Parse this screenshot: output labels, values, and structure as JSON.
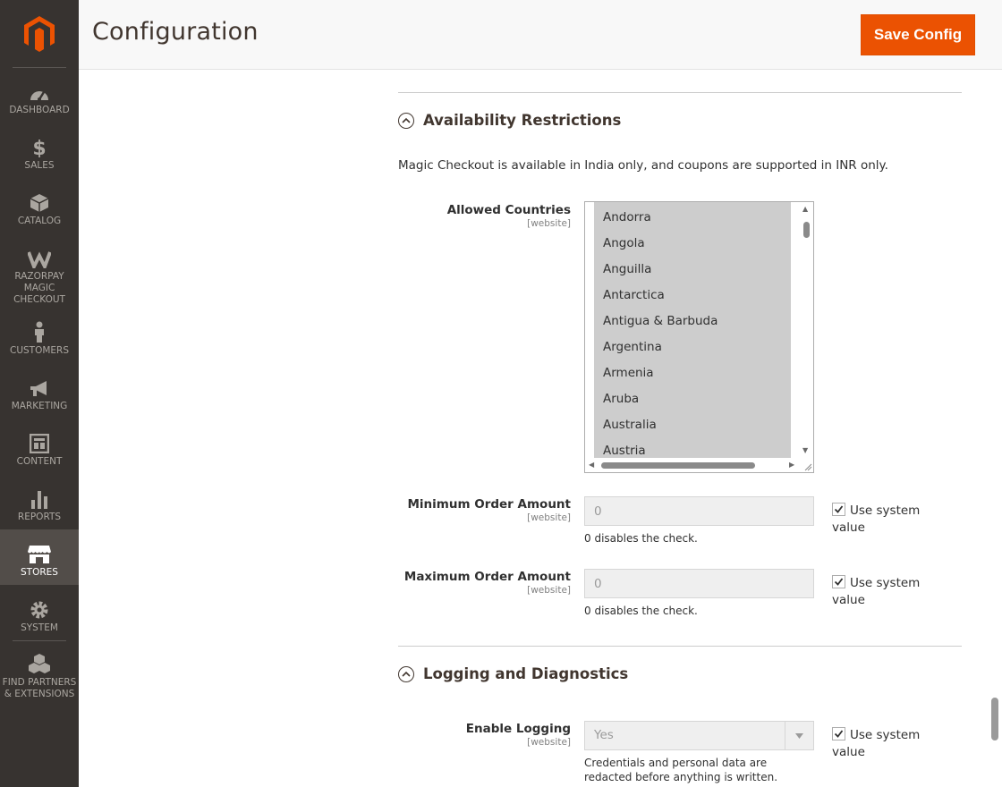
{
  "sidebar": {
    "items": [
      {
        "label": "DASHBOARD",
        "icon": "dashboard-icon"
      },
      {
        "label": "SALES",
        "icon": "dollar-icon"
      },
      {
        "label": "CATALOG",
        "icon": "box-icon"
      },
      {
        "label": "RAZORPAY MAGIC CHECKOUT",
        "icon": "razorpay-icon"
      },
      {
        "label": "CUSTOMERS",
        "icon": "person-icon"
      },
      {
        "label": "MARKETING",
        "icon": "megaphone-icon"
      },
      {
        "label": "CONTENT",
        "icon": "layout-icon"
      },
      {
        "label": "REPORTS",
        "icon": "bar-chart-icon"
      },
      {
        "label": "STORES",
        "icon": "store-icon"
      },
      {
        "label": "SYSTEM",
        "icon": "gear-icon"
      },
      {
        "label": "FIND PARTNERS & EXTENSIONS",
        "icon": "cubes-icon"
      }
    ]
  },
  "header": {
    "title": "Configuration",
    "save_label": "Save Config"
  },
  "availability": {
    "title": "Availability Restrictions",
    "note": "Magic Checkout is available in India only, and coupons are supported in INR only.",
    "allowed_countries": {
      "label": "Allowed Countries",
      "scope": "[website]",
      "options": [
        "Andorra",
        "Angola",
        "Anguilla",
        "Antarctica",
        "Antigua & Barbuda",
        "Argentina",
        "Armenia",
        "Aruba",
        "Australia",
        "Austria"
      ]
    },
    "min_order": {
      "label": "Minimum Order Amount",
      "scope": "[website]",
      "value": "0",
      "hint": "0 disables the check.",
      "use_system": "Use system value"
    },
    "max_order": {
      "label": "Maximum Order Amount",
      "scope": "[website]",
      "value": "0",
      "hint": "0 disables the check.",
      "use_system": "Use system value"
    }
  },
  "logging": {
    "title": "Logging and Diagnostics",
    "enable_logging": {
      "label": "Enable Logging",
      "scope": "[website]",
      "value": "Yes",
      "hint": "Credentials and personal data are redacted before anything is written.",
      "use_system": "Use system value"
    }
  },
  "colors": {
    "accent": "#eb5202",
    "sidebar": "#373330",
    "sidebar_active": "#524d49"
  }
}
